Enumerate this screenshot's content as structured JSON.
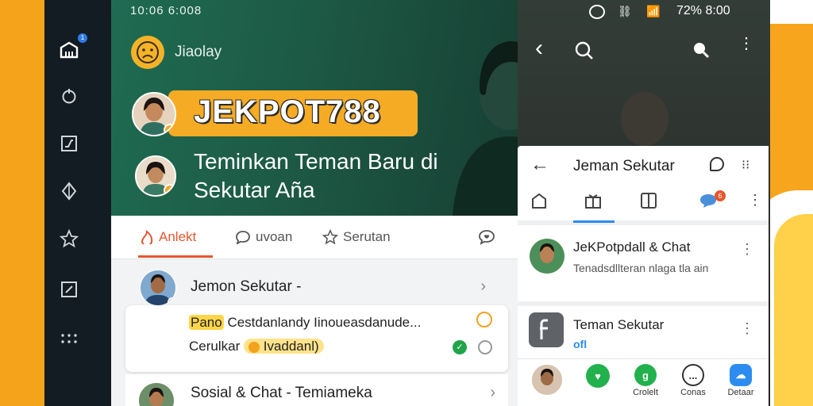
{
  "left_app": {
    "status_text": "10:06 6:008",
    "app_name": "Jiaolay",
    "brand": "JEKPOT788",
    "tagline": "Teminkan Teman Baru di Sekutar Aña",
    "tabs": [
      {
        "label": "Anlekt",
        "icon": "fire-icon",
        "active": true
      },
      {
        "label": "uvoan",
        "icon": "chat-bubble-icon",
        "active": false
      },
      {
        "label": "Serutan",
        "icon": "star-icon",
        "active": false
      }
    ],
    "rows": [
      {
        "title": "Jemon Sekutar -"
      },
      {
        "title": "Sosial & Chat - Temiameka"
      }
    ],
    "card": {
      "pill": "Pano",
      "line1": "Cestdanlandy Iinoueasdanude...",
      "line2_prefix": "Cerulkar",
      "line2_pill": "Ivaddanl)"
    },
    "rail_badge": "1"
  },
  "right_app": {
    "status_text": "72% 8:00",
    "sheet_title": "Jeman Sekutar",
    "tab_badge": "6",
    "chats": [
      {
        "name": "JeKPotpdall & Chat",
        "sub": "Tenadsdllteran nlaga tla ain"
      },
      {
        "name": "Teman Sekutar",
        "sub": "ofl"
      }
    ],
    "dock": [
      {
        "label": "",
        "icon": "avatar-icon"
      },
      {
        "label": "",
        "icon": "heart-icon",
        "color": "#22b14c"
      },
      {
        "label": "Crolelt",
        "icon": "gift-icon",
        "color": "#22b14c",
        "glyph": "g"
      },
      {
        "label": "Conas",
        "icon": "chat-icon",
        "color": "#ffffff",
        "glyph": "..."
      },
      {
        "label": "Detaar",
        "icon": "cloud-icon",
        "color": "#2c8cf0",
        "glyph": "☁"
      }
    ]
  },
  "colors": {
    "accent_orange": "#f6ab24",
    "hero_green": "#1f6b52",
    "active_tab": "#e4572e",
    "rail": "#131c22",
    "blue": "#2c8cf0"
  }
}
